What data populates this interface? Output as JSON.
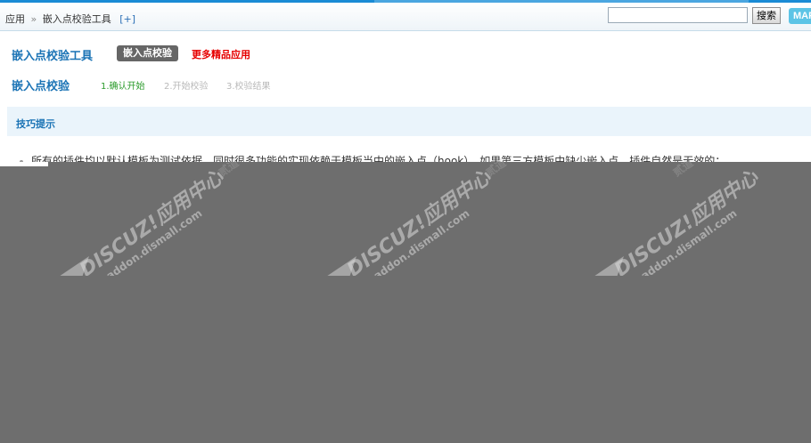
{
  "breadcrumb": {
    "root": "应用",
    "separator": "»",
    "current": "嵌入点校验工具",
    "add": "[+]"
  },
  "search": {
    "placeholder": "",
    "button_label": "搜索"
  },
  "map_button": "MAP",
  "tool": {
    "title": "嵌入点校验工具",
    "badge": "嵌入点校验",
    "more_link": "更多精品应用"
  },
  "steps": {
    "title": "嵌入点校验",
    "items": [
      "1.确认开始",
      "2.开始校验",
      "3.校验结果"
    ]
  },
  "tips": {
    "title": "技巧提示",
    "items": [
      "所有的插件均以默认模板为测试依据，同时很多功能的实现依赖于模板当中的嵌入点（hook），如果第三方模板中缺少嵌入点，插件自然是无效的；"
    ]
  },
  "watermark": {
    "brand": "DISCUZ!应用中心",
    "domain": "addon.dismall.com",
    "mark": "贰道"
  },
  "colors": {
    "accent": "#1a73b5",
    "link_red": "#e60000",
    "step_active": "#2a9a2a",
    "step_inactive": "#b9b9b9",
    "overlay": "#6e6e6e"
  }
}
